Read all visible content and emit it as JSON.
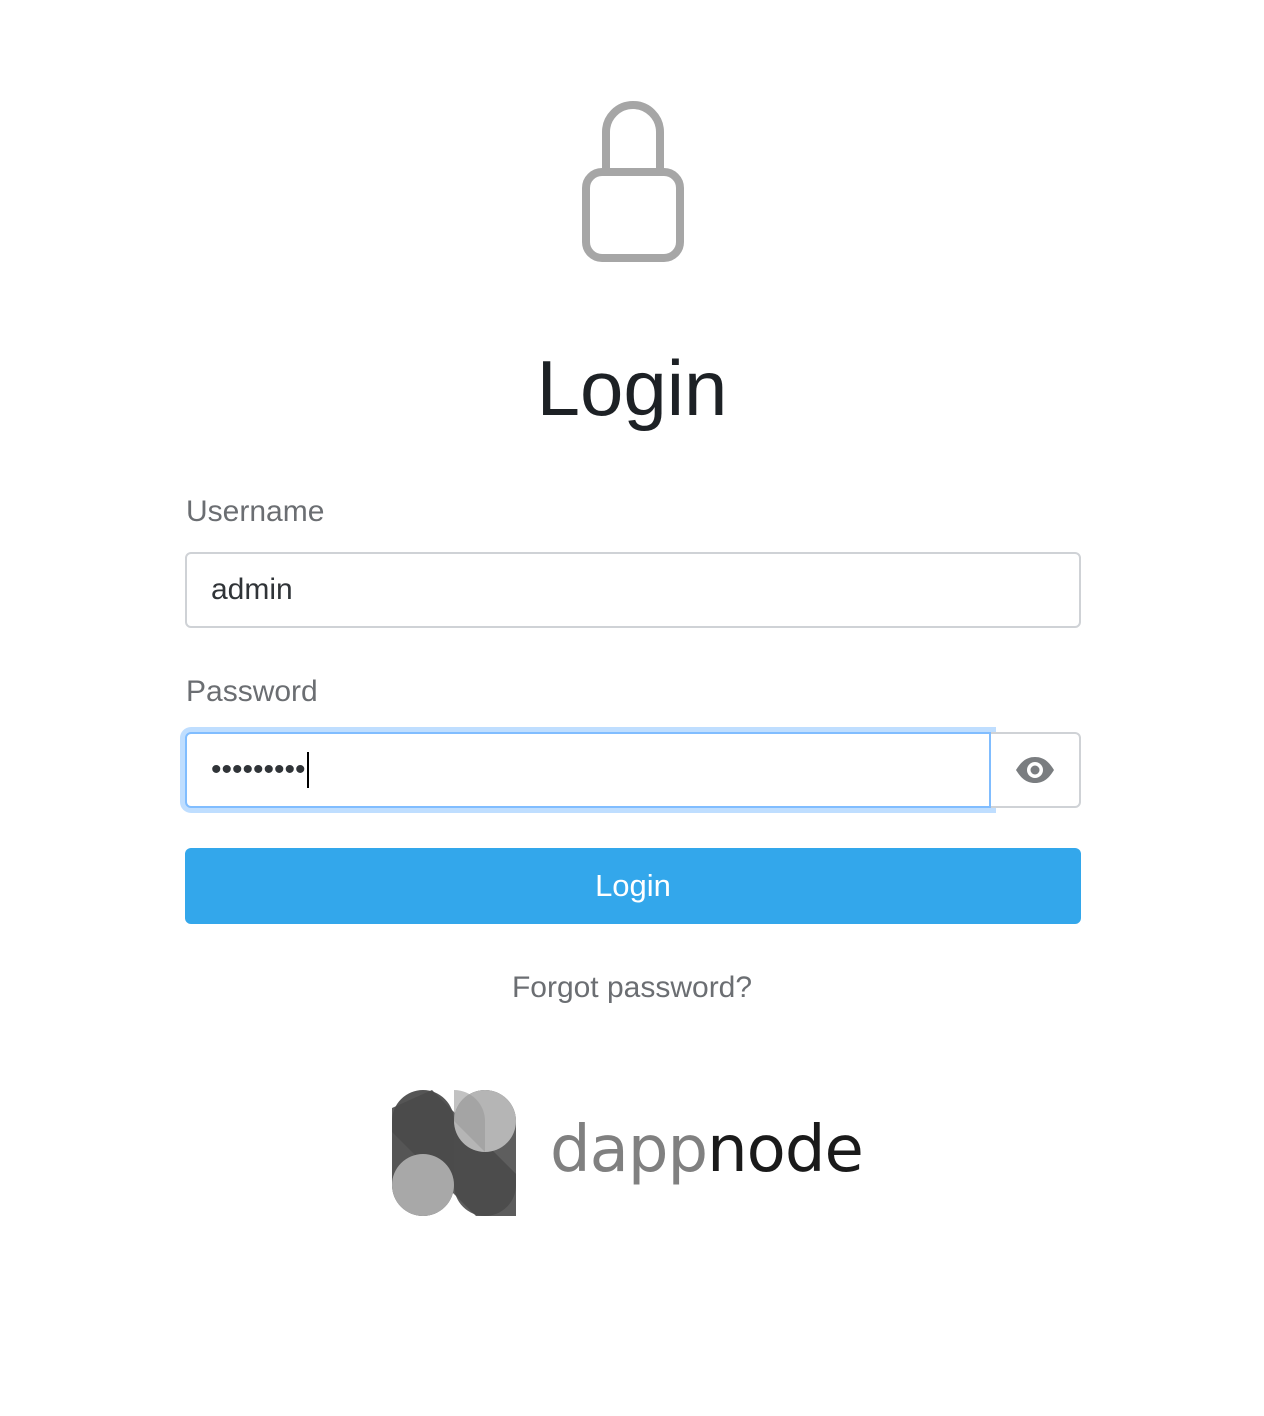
{
  "header": {
    "lock_icon": "lock-icon",
    "title": "Login"
  },
  "form": {
    "username_label": "Username",
    "username_value": "admin",
    "password_label": "Password",
    "password_masked": "•••••••••",
    "show_password_icon": "eye-icon",
    "login_button_label": "Login",
    "forgot_password_label": "Forgot password?"
  },
  "footer": {
    "logo_text_part1": "dapp",
    "logo_text_part2": "node"
  },
  "colors": {
    "primary_button": "#33a7eb",
    "focus_border": "#80bdff",
    "label_text": "#6b6e72",
    "lock_icon": "#a6a6a6"
  }
}
